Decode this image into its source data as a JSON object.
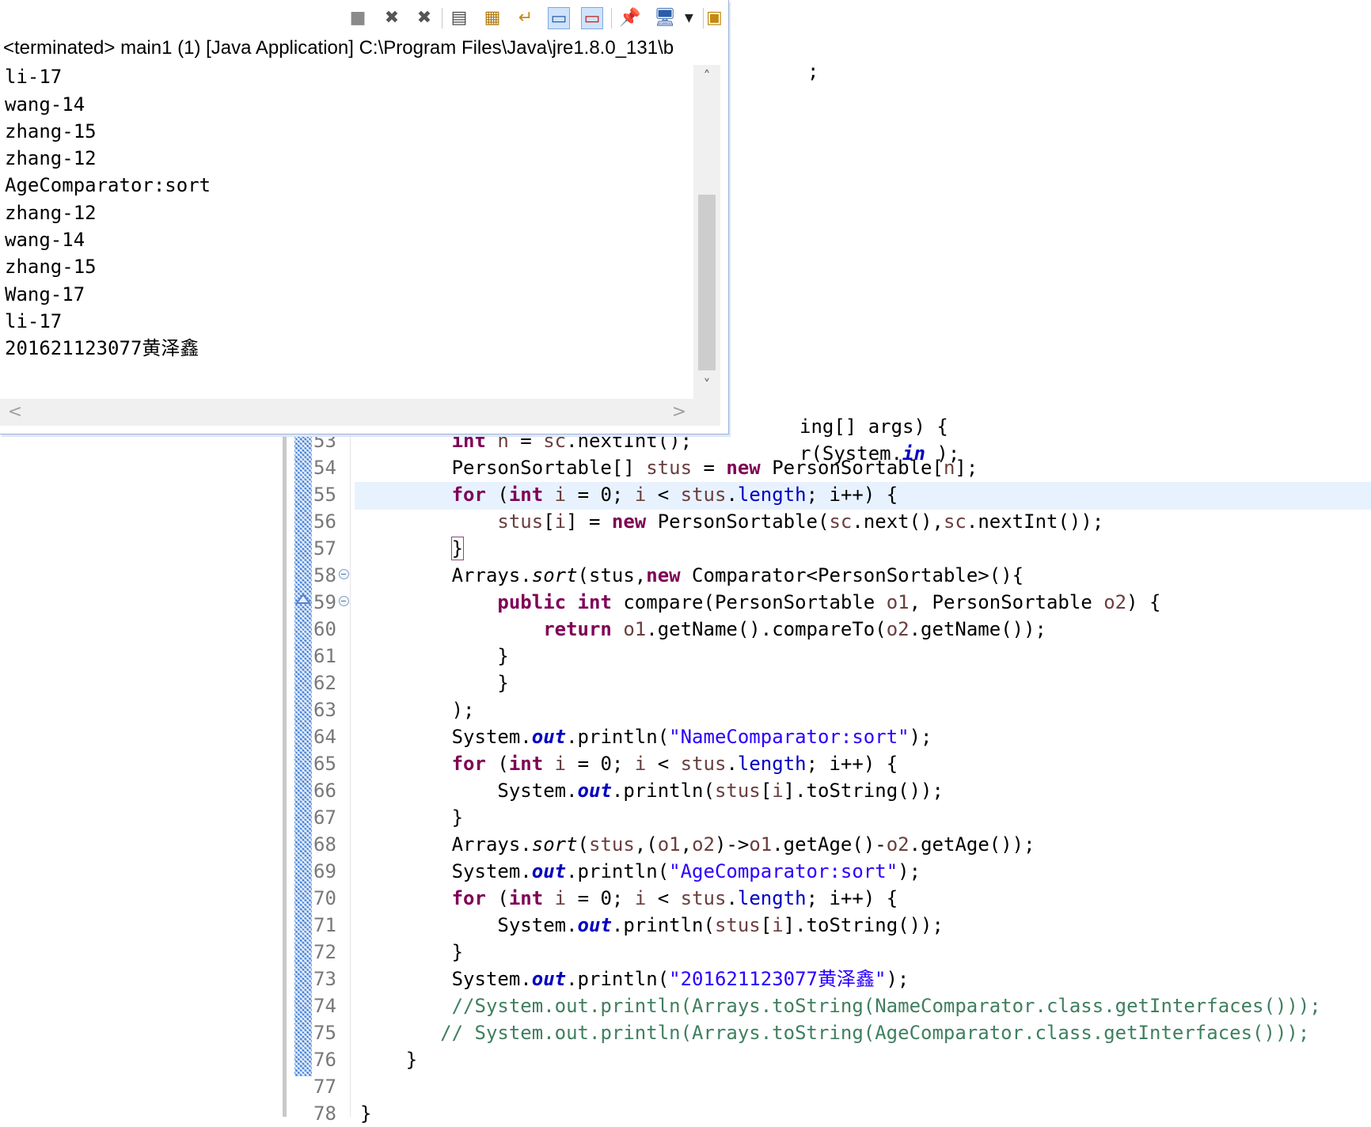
{
  "console": {
    "title": "<terminated> main1 (1) [Java Application] C:\\Program Files\\Java\\jre1.8.0_131\\b",
    "partial_first_line": "wang-17",
    "output_lines": [
      "li-17",
      "wang-14",
      "zhang-15",
      "zhang-12",
      "AgeComparator:sort",
      "zhang-12",
      "wang-14",
      "zhang-15",
      "Wang-17",
      "li-17",
      "201621123077黄泽鑫"
    ],
    "toolbar_icons": [
      "terminate-icon",
      "remove-launch-icon",
      "remove-all-terminated-icon",
      "clear-console-icon",
      "scroll-lock-icon",
      "word-wrap-icon",
      "show-on-stdout-icon",
      "show-on-stderr-icon",
      "pin-console-icon",
      "display-console-icon",
      "open-console-icon"
    ],
    "scroll_up": "˄",
    "scroll_down": "˅",
    "scroll_left": "<",
    "scroll_right": ">"
  },
  "editor": {
    "partial_lines": {
      "semicolon": ";",
      "args_line": "ing[] args) {",
      "system_in_prefix": "r(System.",
      "system_in_field": "in",
      "system_in_suffix": " );"
    },
    "line_numbers": [
      "53",
      "54",
      "55",
      "56",
      "57",
      "58",
      "59",
      "60",
      "61",
      "62",
      "63",
      "64",
      "65",
      "66",
      "67",
      "68",
      "69",
      "70",
      "71",
      "72",
      "73",
      "74",
      "75",
      "76",
      "77",
      "78"
    ],
    "tokens": {
      "int": "int",
      "for": "for",
      "new": "new",
      "public": "public",
      "return": "return",
      "n": "n",
      "sc": "sc",
      "stus": "stus",
      "length": "length",
      "out": "out",
      "sort": "sort",
      "i": "i",
      "o1": "o1",
      "o2": "o2",
      "nextInt": ".nextInt();",
      "personSortableArr": "PersonSortable[] ",
      "personSortableNew": "PersonSortable[",
      "closeArr": "];",
      "eq": " = ",
      "forOpen": " (",
      "forMid": " = 0; ",
      "lt": " < ",
      "dot": ".",
      "forEnd": "; i++) {",
      "newPS": "PersonSortable(",
      "scNext": ".next(),",
      "scNextInt": ".nextInt());",
      "closeBrace": "}",
      "arrays": "Arrays.",
      "sortArgs": "(stus,",
      "comparatorGeneric": " Comparator<PersonSortable>(){",
      "compareSig": " compare(PersonSortable ",
      "compareSig2": ", PersonSortable ",
      "compareSig3": ") {",
      "returnExpr1": ".getName().compareTo(",
      "returnExpr2": ".getName());",
      "closeParen": ");",
      "system": "System.",
      "println": ".println(",
      "printlnStus": ".println(",
      "toStringCall": "].toString());",
      "lambdaOpen": "(",
      "lambdaComma": ",",
      "lambdaArrow": ")->",
      "getAge1": ".getAge()-",
      "getAge2": ".getAge());",
      "strClose": ");",
      "bracketOpen": "["
    },
    "strings": {
      "name_sort": "\"NameComparator:sort\"",
      "age_sort": "\"AgeComparator:sort\"",
      "student_id": "\"201621123077黄泽鑫\""
    },
    "comments": {
      "line74": "//System.out.println(Arrays.toString(NameComparator.class.getInterfaces()));",
      "line75": "// System.out.println(Arrays.toString(AgeComparator.class.getInterfaces()));"
    }
  }
}
